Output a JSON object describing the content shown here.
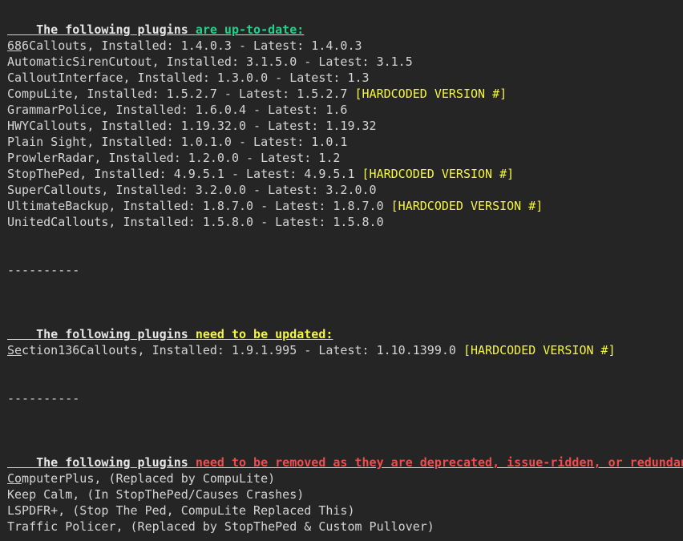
{
  "up_to_date": {
    "heading_lead": "The following plugins",
    "heading_status": "are up-to-date:",
    "status_color": "#23d18b",
    "items": [
      {
        "text": "686Callouts, Installed: 1.4.0.3 - Latest: 1.4.0.3",
        "tag": ""
      },
      {
        "text": "AutomaticSirenCutout, Installed: 3.1.5.0 - Latest: 3.1.5",
        "tag": ""
      },
      {
        "text": "CalloutInterface, Installed: 1.3.0.0 - Latest: 1.3",
        "tag": ""
      },
      {
        "text": "CompuLite, Installed: 1.5.2.7 - Latest: 1.5.2.7",
        "tag": "[HARDCODED VERSION #]"
      },
      {
        "text": "GrammarPolice, Installed: 1.6.0.4 - Latest: 1.6",
        "tag": ""
      },
      {
        "text": "HWYCallouts, Installed: 1.19.32.0 - Latest: 1.19.32",
        "tag": ""
      },
      {
        "text": "Plain Sight, Installed: 1.0.1.0 - Latest: 1.0.1",
        "tag": ""
      },
      {
        "text": "ProwlerRadar, Installed: 1.2.0.0 - Latest: 1.2",
        "tag": ""
      },
      {
        "text": "StopThePed, Installed: 4.9.5.1 - Latest: 4.9.5.1",
        "tag": "[HARDCODED VERSION #]"
      },
      {
        "text": "SuperCallouts, Installed: 3.2.0.0 - Latest: 3.2.0.0",
        "tag": ""
      },
      {
        "text": "UltimateBackup, Installed: 1.8.7.0 - Latest: 1.8.7.0",
        "tag": "[HARDCODED VERSION #]"
      },
      {
        "text": "UnitedCallouts, Installed: 1.5.8.0 - Latest: 1.5.8.0",
        "tag": ""
      }
    ]
  },
  "separator_1": "----------",
  "need_update": {
    "heading_lead": "The following plugins",
    "heading_status": "need to be updated:",
    "status_color": "#f5f543",
    "items": [
      {
        "text": "Section136Callouts, Installed: 1.9.1.995 - Latest: 1.10.1399.0",
        "tag": "[HARDCODED VERSION #]"
      }
    ]
  },
  "separator_2": "----------",
  "to_remove": {
    "heading_lead": "The following plugins",
    "heading_status": "need to be removed as they are deprecated, issue-ridden, or redundant:",
    "status_color": "#f14c4c",
    "items": [
      {
        "text": "ComputerPlus, (Replaced by CompuLite)"
      },
      {
        "text": "Keep Calm, (In StopThePed/Causes Crashes)"
      },
      {
        "text": "LSPDFR+, (Stop The Ped, CompuLite Replaced This)"
      },
      {
        "text": "Traffic Policer, (Replaced by StopThePed & Custom Pullover)"
      }
    ]
  },
  "tag_color": "#f5f543"
}
